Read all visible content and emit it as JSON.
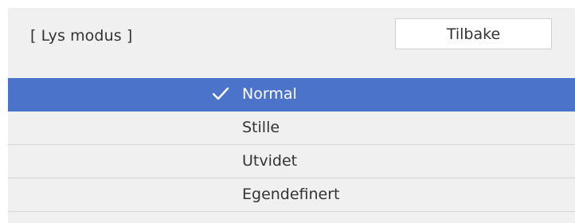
{
  "panel": {
    "title": "[ Lys modus ]",
    "back_label": "Tilbake"
  },
  "options": [
    {
      "label": "Normal",
      "selected": true
    },
    {
      "label": "Stille",
      "selected": false
    },
    {
      "label": "Utvidet",
      "selected": false
    },
    {
      "label": "Egendefinert",
      "selected": false
    }
  ],
  "colors": {
    "selected_background": "#4a73c9",
    "panel_background": "#f0f0f0"
  },
  "icons": {
    "selected_indicator": "checkmark-icon"
  }
}
